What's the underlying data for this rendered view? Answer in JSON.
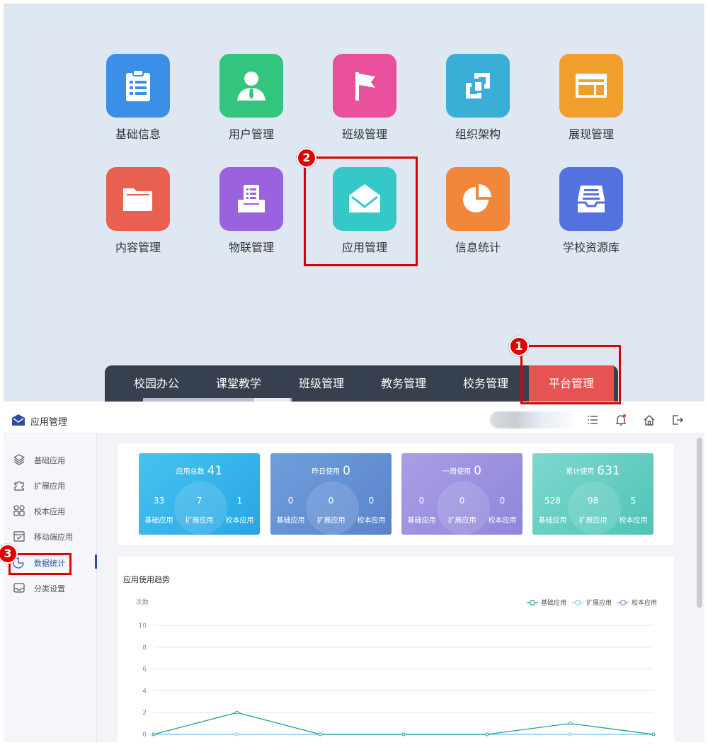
{
  "portal": {
    "tiles": [
      {
        "label": "基础信息",
        "icon": "clipboard-list-icon",
        "color": "#3b8fe6"
      },
      {
        "label": "用户管理",
        "icon": "user-tie-icon",
        "color": "#33c47d"
      },
      {
        "label": "班级管理",
        "icon": "flag-icon",
        "color": "#e8509b"
      },
      {
        "label": "组织架构",
        "icon": "org-structure-icon",
        "color": "#3baed8"
      },
      {
        "label": "展现管理",
        "icon": "layout-icon",
        "color": "#f09f2c"
      },
      {
        "label": "内容管理",
        "icon": "folder-icon",
        "color": "#e8604f"
      },
      {
        "label": "物联管理",
        "icon": "inbox-document-icon",
        "color": "#9a63dd"
      },
      {
        "label": "应用管理",
        "icon": "envelope-open-icon",
        "color": "#36c8c9"
      },
      {
        "label": "信息统计",
        "icon": "pie-chart-icon",
        "color": "#f0873a"
      },
      {
        "label": "学校资源库",
        "icon": "archive-tray-icon",
        "color": "#5471e0"
      }
    ],
    "nav": [
      "校园办公",
      "课堂教学",
      "班级管理",
      "教务管理",
      "校务管理",
      "平台管理"
    ],
    "nav_active": "平台管理"
  },
  "badges": {
    "one": "1",
    "two": "2",
    "three": "3"
  },
  "app": {
    "title": "应用管理",
    "sidebar": [
      {
        "label": "基础应用",
        "icon": "layers-icon"
      },
      {
        "label": "扩展应用",
        "icon": "puzzle-icon"
      },
      {
        "label": "校本应用",
        "icon": "grid-apps-icon"
      },
      {
        "label": "移动端应用",
        "icon": "calendar-check-icon"
      },
      {
        "label": "数据统计",
        "icon": "pie-outline-icon"
      },
      {
        "label": "分类设置",
        "icon": "inbox-icon"
      }
    ],
    "sidebar_active": "数据统计",
    "stats": [
      {
        "title": "应用总数",
        "value": "41",
        "grad": [
          "#47c2f0",
          "#27a6e4"
        ],
        "items": [
          {
            "n": "33",
            "l": "基础应用"
          },
          {
            "n": "7",
            "l": "扩展应用"
          },
          {
            "n": "1",
            "l": "校本应用"
          }
        ]
      },
      {
        "title": "昨日使用",
        "value": "0",
        "grad": [
          "#6f9fdc",
          "#5b83cc"
        ],
        "items": [
          {
            "n": "0",
            "l": "基础应用"
          },
          {
            "n": "0",
            "l": "扩展应用"
          },
          {
            "n": "0",
            "l": "校本应用"
          }
        ]
      },
      {
        "title": "一周使用",
        "value": "0",
        "grad": [
          "#a89fe5",
          "#8f86da"
        ],
        "items": [
          {
            "n": "0",
            "l": "基础应用"
          },
          {
            "n": "0",
            "l": "扩展应用"
          },
          {
            "n": "0",
            "l": "校本应用"
          }
        ]
      },
      {
        "title": "累计使用",
        "value": "631",
        "grad": [
          "#7ed8cd",
          "#4fc4b7"
        ],
        "items": [
          {
            "n": "528",
            "l": "基础应用"
          },
          {
            "n": "98",
            "l": "扩展应用"
          },
          {
            "n": "5",
            "l": "校本应用"
          }
        ]
      }
    ]
  },
  "chart_data": {
    "type": "line",
    "title": "应用使用趋势",
    "ylabel": "次数",
    "ylim": [
      0,
      10
    ],
    "yticks": [
      "10",
      "8",
      "6",
      "4",
      "2",
      "0"
    ],
    "legend": "top-right",
    "grid": true,
    "series": [
      {
        "name": "基础应用",
        "color": "#1aa392",
        "values": [
          0,
          2,
          0,
          0,
          0,
          1,
          0
        ]
      },
      {
        "name": "扩展应用",
        "color": "#7cd2ee",
        "values": [
          0,
          0,
          0,
          0,
          0,
          0,
          0
        ]
      },
      {
        "name": "校本应用",
        "color": "#b173d9",
        "values": [
          0,
          0,
          0,
          0,
          0,
          0,
          0
        ]
      }
    ]
  }
}
